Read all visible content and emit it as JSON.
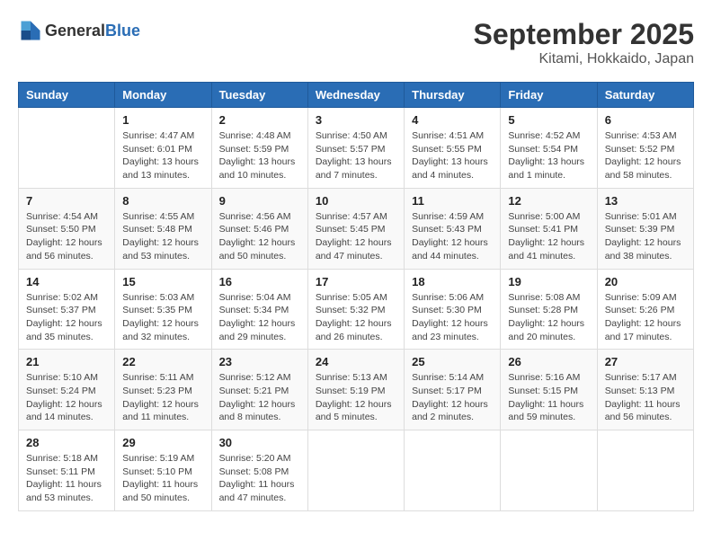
{
  "header": {
    "logo_general": "General",
    "logo_blue": "Blue",
    "month": "September 2025",
    "location": "Kitami, Hokkaido, Japan"
  },
  "weekdays": [
    "Sunday",
    "Monday",
    "Tuesday",
    "Wednesday",
    "Thursday",
    "Friday",
    "Saturday"
  ],
  "weeks": [
    [
      {
        "day": "",
        "info": ""
      },
      {
        "day": "1",
        "info": "Sunrise: 4:47 AM\nSunset: 6:01 PM\nDaylight: 13 hours\nand 13 minutes."
      },
      {
        "day": "2",
        "info": "Sunrise: 4:48 AM\nSunset: 5:59 PM\nDaylight: 13 hours\nand 10 minutes."
      },
      {
        "day": "3",
        "info": "Sunrise: 4:50 AM\nSunset: 5:57 PM\nDaylight: 13 hours\nand 7 minutes."
      },
      {
        "day": "4",
        "info": "Sunrise: 4:51 AM\nSunset: 5:55 PM\nDaylight: 13 hours\nand 4 minutes."
      },
      {
        "day": "5",
        "info": "Sunrise: 4:52 AM\nSunset: 5:54 PM\nDaylight: 13 hours\nand 1 minute."
      },
      {
        "day": "6",
        "info": "Sunrise: 4:53 AM\nSunset: 5:52 PM\nDaylight: 12 hours\nand 58 minutes."
      }
    ],
    [
      {
        "day": "7",
        "info": "Sunrise: 4:54 AM\nSunset: 5:50 PM\nDaylight: 12 hours\nand 56 minutes."
      },
      {
        "day": "8",
        "info": "Sunrise: 4:55 AM\nSunset: 5:48 PM\nDaylight: 12 hours\nand 53 minutes."
      },
      {
        "day": "9",
        "info": "Sunrise: 4:56 AM\nSunset: 5:46 PM\nDaylight: 12 hours\nand 50 minutes."
      },
      {
        "day": "10",
        "info": "Sunrise: 4:57 AM\nSunset: 5:45 PM\nDaylight: 12 hours\nand 47 minutes."
      },
      {
        "day": "11",
        "info": "Sunrise: 4:59 AM\nSunset: 5:43 PM\nDaylight: 12 hours\nand 44 minutes."
      },
      {
        "day": "12",
        "info": "Sunrise: 5:00 AM\nSunset: 5:41 PM\nDaylight: 12 hours\nand 41 minutes."
      },
      {
        "day": "13",
        "info": "Sunrise: 5:01 AM\nSunset: 5:39 PM\nDaylight: 12 hours\nand 38 minutes."
      }
    ],
    [
      {
        "day": "14",
        "info": "Sunrise: 5:02 AM\nSunset: 5:37 PM\nDaylight: 12 hours\nand 35 minutes."
      },
      {
        "day": "15",
        "info": "Sunrise: 5:03 AM\nSunset: 5:35 PM\nDaylight: 12 hours\nand 32 minutes."
      },
      {
        "day": "16",
        "info": "Sunrise: 5:04 AM\nSunset: 5:34 PM\nDaylight: 12 hours\nand 29 minutes."
      },
      {
        "day": "17",
        "info": "Sunrise: 5:05 AM\nSunset: 5:32 PM\nDaylight: 12 hours\nand 26 minutes."
      },
      {
        "day": "18",
        "info": "Sunrise: 5:06 AM\nSunset: 5:30 PM\nDaylight: 12 hours\nand 23 minutes."
      },
      {
        "day": "19",
        "info": "Sunrise: 5:08 AM\nSunset: 5:28 PM\nDaylight: 12 hours\nand 20 minutes."
      },
      {
        "day": "20",
        "info": "Sunrise: 5:09 AM\nSunset: 5:26 PM\nDaylight: 12 hours\nand 17 minutes."
      }
    ],
    [
      {
        "day": "21",
        "info": "Sunrise: 5:10 AM\nSunset: 5:24 PM\nDaylight: 12 hours\nand 14 minutes."
      },
      {
        "day": "22",
        "info": "Sunrise: 5:11 AM\nSunset: 5:23 PM\nDaylight: 12 hours\nand 11 minutes."
      },
      {
        "day": "23",
        "info": "Sunrise: 5:12 AM\nSunset: 5:21 PM\nDaylight: 12 hours\nand 8 minutes."
      },
      {
        "day": "24",
        "info": "Sunrise: 5:13 AM\nSunset: 5:19 PM\nDaylight: 12 hours\nand 5 minutes."
      },
      {
        "day": "25",
        "info": "Sunrise: 5:14 AM\nSunset: 5:17 PM\nDaylight: 12 hours\nand 2 minutes."
      },
      {
        "day": "26",
        "info": "Sunrise: 5:16 AM\nSunset: 5:15 PM\nDaylight: 11 hours\nand 59 minutes."
      },
      {
        "day": "27",
        "info": "Sunrise: 5:17 AM\nSunset: 5:13 PM\nDaylight: 11 hours\nand 56 minutes."
      }
    ],
    [
      {
        "day": "28",
        "info": "Sunrise: 5:18 AM\nSunset: 5:11 PM\nDaylight: 11 hours\nand 53 minutes."
      },
      {
        "day": "29",
        "info": "Sunrise: 5:19 AM\nSunset: 5:10 PM\nDaylight: 11 hours\nand 50 minutes."
      },
      {
        "day": "30",
        "info": "Sunrise: 5:20 AM\nSunset: 5:08 PM\nDaylight: 11 hours\nand 47 minutes."
      },
      {
        "day": "",
        "info": ""
      },
      {
        "day": "",
        "info": ""
      },
      {
        "day": "",
        "info": ""
      },
      {
        "day": "",
        "info": ""
      }
    ]
  ]
}
